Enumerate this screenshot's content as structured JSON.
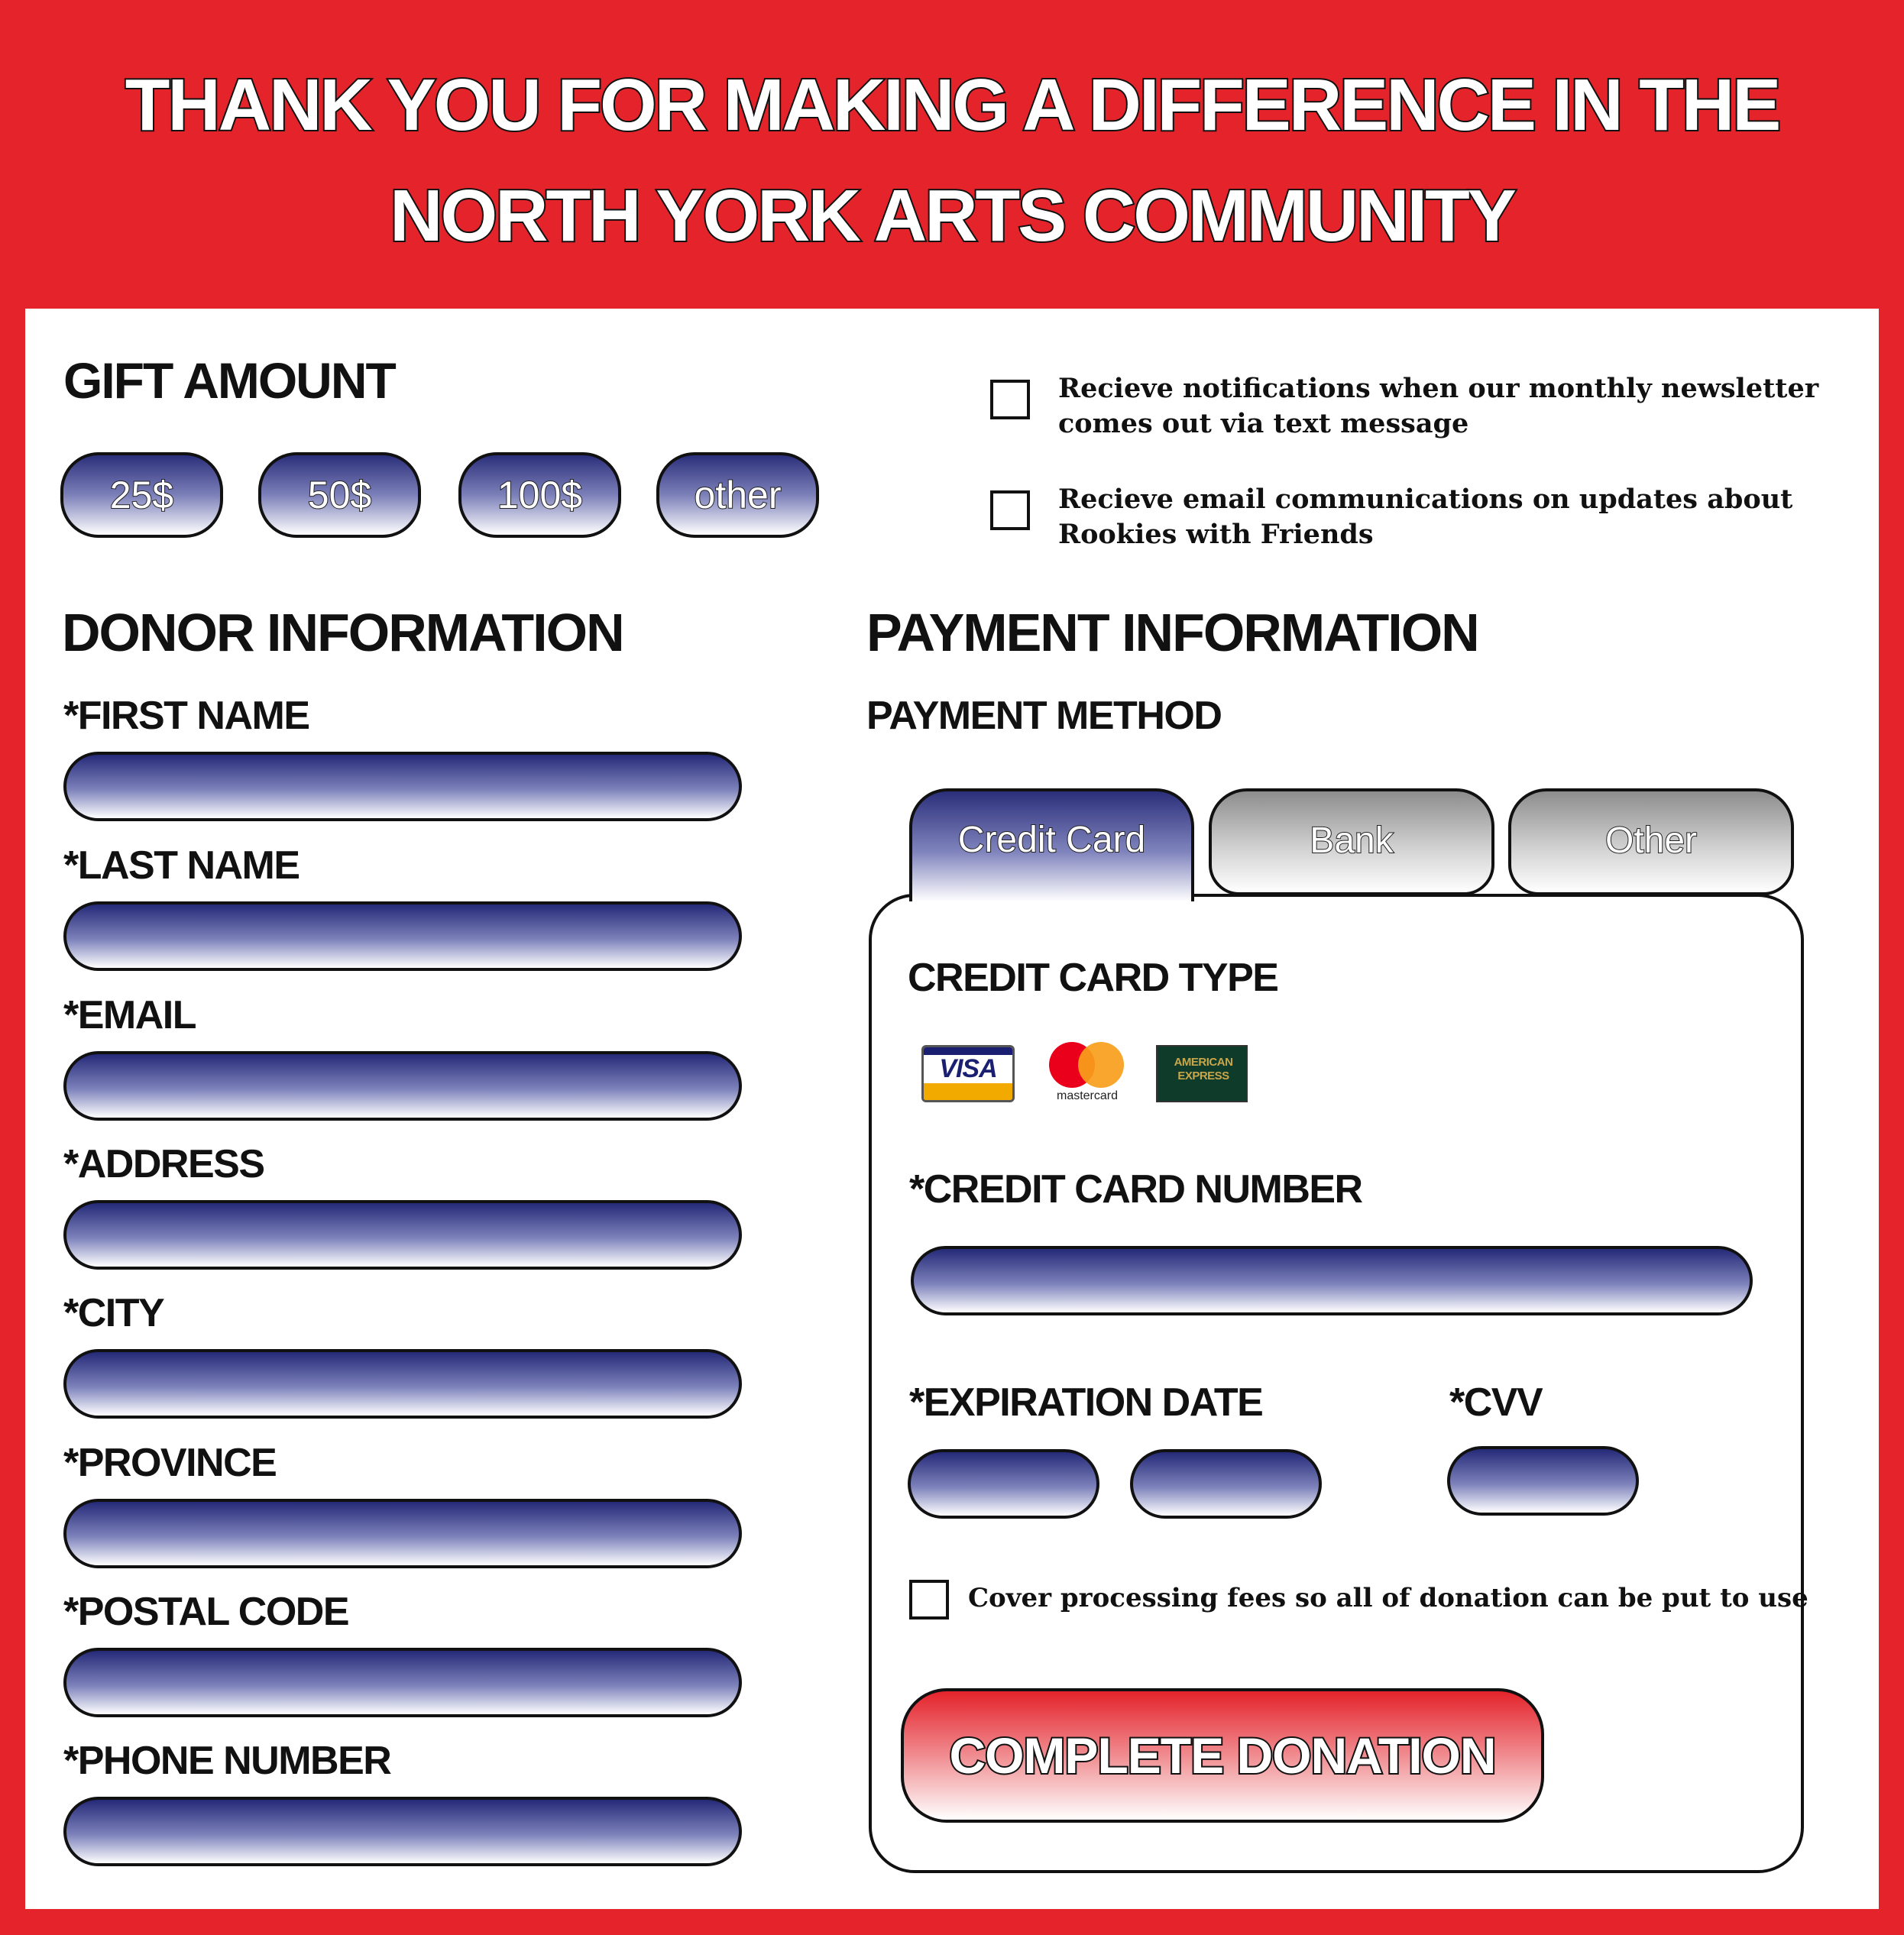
{
  "header": {
    "line1": "THANK YOU FOR MAKING A DIFFERENCE IN THE",
    "line2": "NORTH YORK ARTS COMMUNITY"
  },
  "gift": {
    "title": "GIFT AMOUNT",
    "options": [
      "25$",
      "50$",
      "100$",
      "other"
    ]
  },
  "notifications": {
    "sms_line1": "Recieve notifications when our monthly newsletter",
    "sms_line2": "comes out via text message",
    "email_line1": "Recieve email communications on updates about",
    "email_line2": "Rookies with Friends"
  },
  "donor": {
    "title": "DONOR INFORMATION",
    "fields": {
      "first_name": "*FIRST NAME",
      "last_name": "*LAST NAME",
      "email": "*EMAIL",
      "address": "*ADDRESS",
      "city": "*CITY",
      "province": "*PROVINCE",
      "postal_code": "*POSTAL CODE",
      "phone_number": "*PHONE NUMBER"
    }
  },
  "payment": {
    "title": "PAYMENT INFORMATION",
    "method_label": "PAYMENT METHOD",
    "tabs": [
      "Credit Card",
      "Bank",
      "Other"
    ],
    "active_tab": "Credit Card",
    "card_type_label": "CREDIT CARD TYPE",
    "card_logos": {
      "visa": "VISA",
      "mastercard": "mastercard",
      "amex_line1": "AMERICAN",
      "amex_line2": "EXPRESS"
    },
    "card_number_label": "*CREDIT CARD NUMBER",
    "expiration_label": "*EXPIRATION DATE",
    "cvv_label": "*CVV",
    "cover_fees": "Cover processing fees so all of donation can be put to use",
    "submit_label": "COMPLETE DONATION"
  },
  "colors": {
    "brand_red": "#e4232b",
    "field_navy": "#252a78",
    "tab_gray": "#8d8d8d"
  }
}
